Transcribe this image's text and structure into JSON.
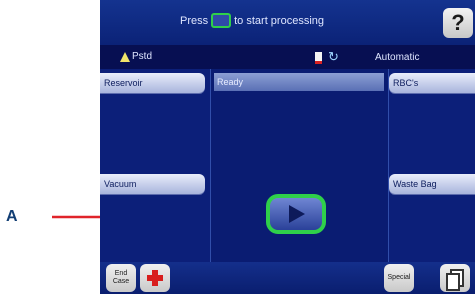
{
  "header": {
    "prompt_before": "Press",
    "prompt_after": "to start processing",
    "help_label": "?"
  },
  "status": {
    "user_label": "Pstd",
    "mode": "Automatic"
  },
  "panels": {
    "left_top": "Reservoir",
    "left_bottom": "Vacuum",
    "middle_status": "Ready",
    "right_top": "RBC's",
    "right_bottom": "Waste Bag"
  },
  "footer": {
    "end_case_line1": "End",
    "end_case_line2": "Case",
    "special_label": "Special"
  },
  "annotation": {
    "label": "A",
    "arrow_color": "#e0242a"
  },
  "colors": {
    "accent_green": "#2fd04a",
    "panel_blue": "#0c1f79"
  },
  "icons": [
    "play-icon",
    "help-icon",
    "warning-triangle-icon",
    "sync-icon",
    "bag-icon",
    "red-cross-icon",
    "copy-icon"
  ]
}
